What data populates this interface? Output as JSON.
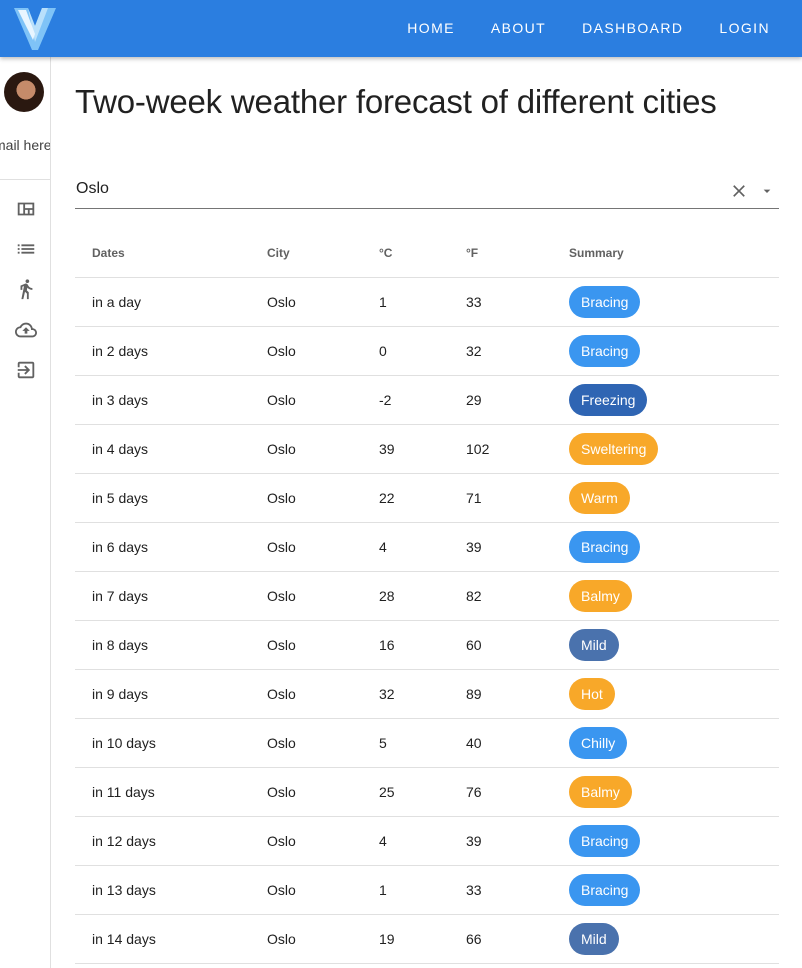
{
  "nav": {
    "items": [
      "HOME",
      "ABOUT",
      "DASHBOARD",
      "LOGIN"
    ]
  },
  "sidebar": {
    "email": "mail here",
    "icons": [
      "view-quilt-icon",
      "list-icon",
      "walk-icon",
      "cloud-upload-icon",
      "exit-icon"
    ]
  },
  "page": {
    "title": "Two-week weather forecast of different cities"
  },
  "search": {
    "value": "Oslo"
  },
  "table": {
    "headers": {
      "dates": "Dates",
      "city": "City",
      "celsius": "°C",
      "fahrenheit": "°F",
      "summary": "Summary"
    },
    "rows": [
      {
        "date": "in a day",
        "city": "Oslo",
        "c": "1",
        "f": "33",
        "summary": "Bracing",
        "color": "#3a96f0"
      },
      {
        "date": "in 2 days",
        "city": "Oslo",
        "c": "0",
        "f": "32",
        "summary": "Bracing",
        "color": "#3a96f0"
      },
      {
        "date": "in 3 days",
        "city": "Oslo",
        "c": "-2",
        "f": "29",
        "summary": "Freezing",
        "color": "#2f65b3"
      },
      {
        "date": "in 4 days",
        "city": "Oslo",
        "c": "39",
        "f": "102",
        "summary": "Sweltering",
        "color": "#f8a829"
      },
      {
        "date": "in 5 days",
        "city": "Oslo",
        "c": "22",
        "f": "71",
        "summary": "Warm",
        "color": "#f8a829"
      },
      {
        "date": "in 6 days",
        "city": "Oslo",
        "c": "4",
        "f": "39",
        "summary": "Bracing",
        "color": "#3a96f0"
      },
      {
        "date": "in 7 days",
        "city": "Oslo",
        "c": "28",
        "f": "82",
        "summary": "Balmy",
        "color": "#f8a829"
      },
      {
        "date": "in 8 days",
        "city": "Oslo",
        "c": "16",
        "f": "60",
        "summary": "Mild",
        "color": "#4a72ad"
      },
      {
        "date": "in 9 days",
        "city": "Oslo",
        "c": "32",
        "f": "89",
        "summary": "Hot",
        "color": "#f8a829"
      },
      {
        "date": "in 10 days",
        "city": "Oslo",
        "c": "5",
        "f": "40",
        "summary": "Chilly",
        "color": "#3a96f0"
      },
      {
        "date": "in 11 days",
        "city": "Oslo",
        "c": "25",
        "f": "76",
        "summary": "Balmy",
        "color": "#f8a829"
      },
      {
        "date": "in 12 days",
        "city": "Oslo",
        "c": "4",
        "f": "39",
        "summary": "Bracing",
        "color": "#3a96f0"
      },
      {
        "date": "in 13 days",
        "city": "Oslo",
        "c": "1",
        "f": "33",
        "summary": "Bracing",
        "color": "#3a96f0"
      },
      {
        "date": "in 14 days",
        "city": "Oslo",
        "c": "19",
        "f": "66",
        "summary": "Mild",
        "color": "#4a72ad"
      }
    ]
  },
  "colors": {
    "app_bar": "#2b7ee0",
    "cold_chip": "#3a96f0",
    "warm_chip": "#f8a829",
    "mild_chip": "#4a72ad",
    "freezing_chip": "#2f65b3"
  }
}
